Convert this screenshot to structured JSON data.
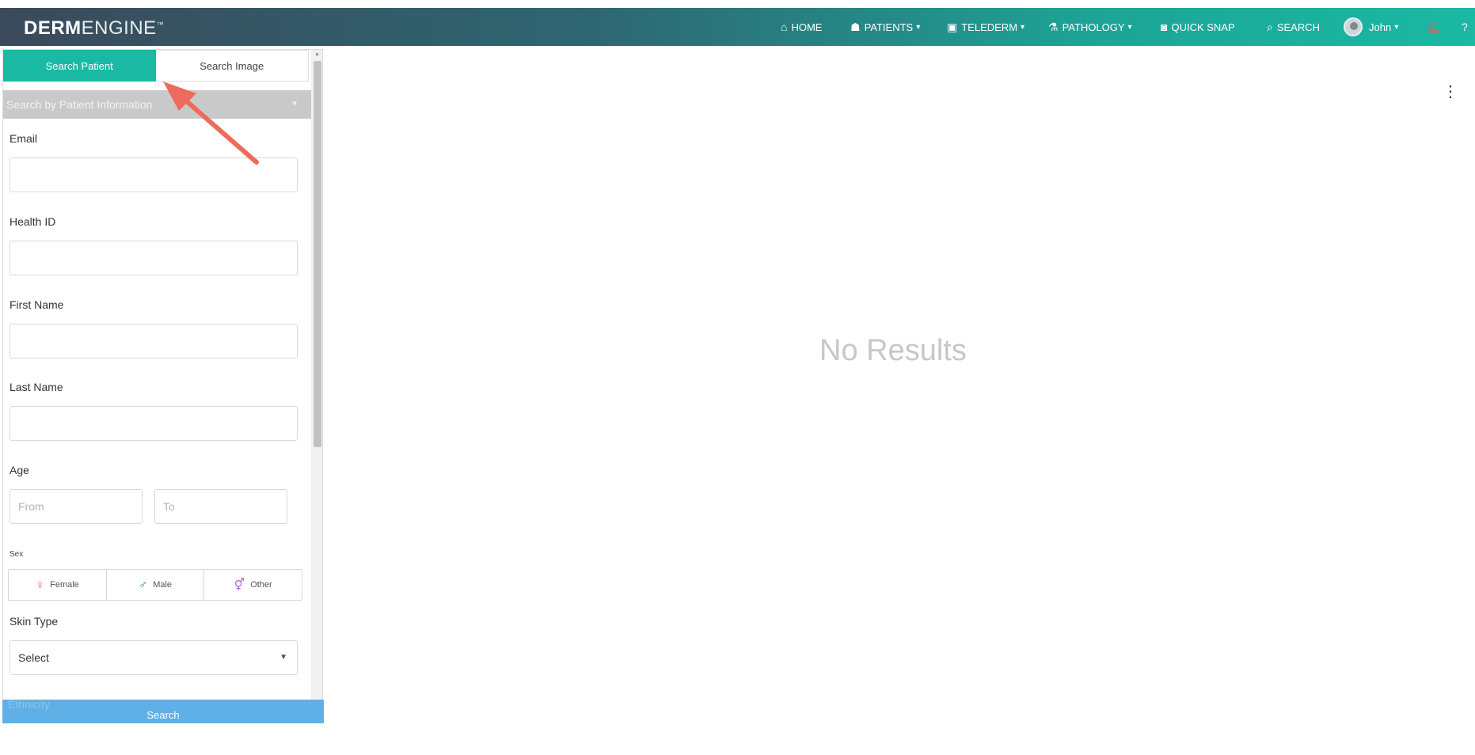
{
  "brand": {
    "bold": "DERM",
    "light": "ENGINE",
    "tm": "™"
  },
  "nav": {
    "home": "HOME",
    "patients": "PATIENTS",
    "telederm": "TELEDERM",
    "pathology": "PATHOLOGY",
    "quick_snap": "QUICK SNAP",
    "search": "SEARCH",
    "user": "John"
  },
  "tabs": {
    "search_patient": "Search Patient",
    "search_image": "Search Image"
  },
  "section_header": "Search by Patient Information",
  "form": {
    "email_label": "Email",
    "health_id_label": "Health ID",
    "first_name_label": "First Name",
    "last_name_label": "Last Name",
    "age_label": "Age",
    "age_from_placeholder": "From",
    "age_to_placeholder": "To",
    "sex_label": "Sex",
    "sex_options": [
      "Female",
      "Male",
      "Other"
    ],
    "skin_type_label": "Skin Type",
    "skin_type_value": "Select",
    "ethnicity_label": "Ethnicity",
    "search_button": "Search"
  },
  "main": {
    "no_results": "No Results"
  },
  "colors": {
    "accent": "#1ab9a4",
    "female": "#e8574f",
    "male": "#1a8fb8",
    "other": "#b366e0",
    "search_button": "#5fb0e6",
    "annotation_arrow": "#ee6a5a"
  },
  "icons": {
    "home": "home-icon",
    "patients": "patients-icon",
    "telederm": "telederm-icon",
    "pathology": "microscope-icon",
    "quick_snap": "camera-icon",
    "search": "search-icon",
    "notifications": "bell-icon",
    "help": "help-icon",
    "more": "kebab-menu-icon"
  }
}
